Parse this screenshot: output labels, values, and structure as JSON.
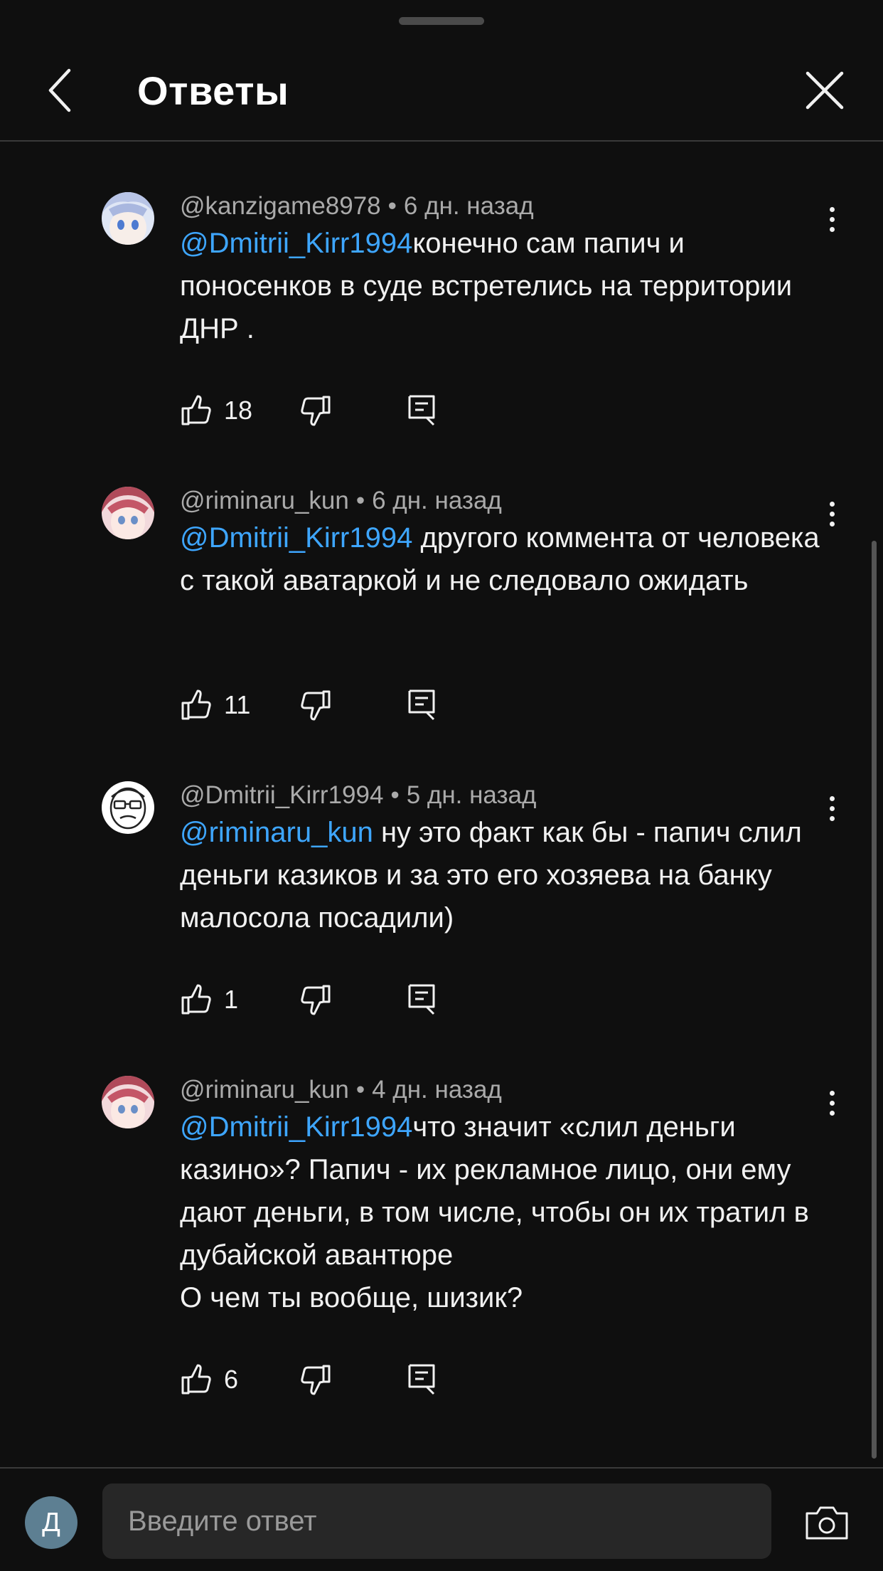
{
  "header": {
    "title": "Ответы",
    "back_icon": "chevron-left-icon",
    "close_icon": "close-icon"
  },
  "colors": {
    "background": "#0f0f0f",
    "mention": "#3ea6ff",
    "meta": "#aaaaaa",
    "input_bg": "#272727",
    "my_avatar": "#5d7f92"
  },
  "comments": [
    {
      "author": "@kanzigame8978",
      "time": "6 дн. назад",
      "mention": "@Dmitrii_Kirr1994",
      "body": "конечно сам папич и поносенков в суде встретелись на территории ДНР .",
      "likes": "18"
    },
    {
      "author": "@riminaru_kun",
      "time": "6 дн. назад",
      "mention": "@Dmitrii_Kirr1994",
      "body": " другого коммента от человека с такой аватаркой и не следовало ожидать",
      "likes": "11"
    },
    {
      "author": "@Dmitrii_Kirr1994",
      "time": "5 дн. назад",
      "mention": "@riminaru_kun",
      "body": " ну это факт как бы - папич слил деньги казиков и за это его хозяева на банку малосола посадили)",
      "likes": "1"
    },
    {
      "author": "@riminaru_kun",
      "time": "4 дн. назад",
      "mention": "@Dmitrii_Kirr1994",
      "body": "что значит «слил деньги казино»? Папич - их рекламное лицо, они ему дают деньги, в том числе, чтобы он их тратил в дубайской авантюре",
      "body2": "О чем ты вообще, шизик?",
      "likes": "6"
    }
  ],
  "composer": {
    "avatar_letter": "Д",
    "placeholder": "Введите ответ",
    "camera_icon": "camera-icon"
  }
}
